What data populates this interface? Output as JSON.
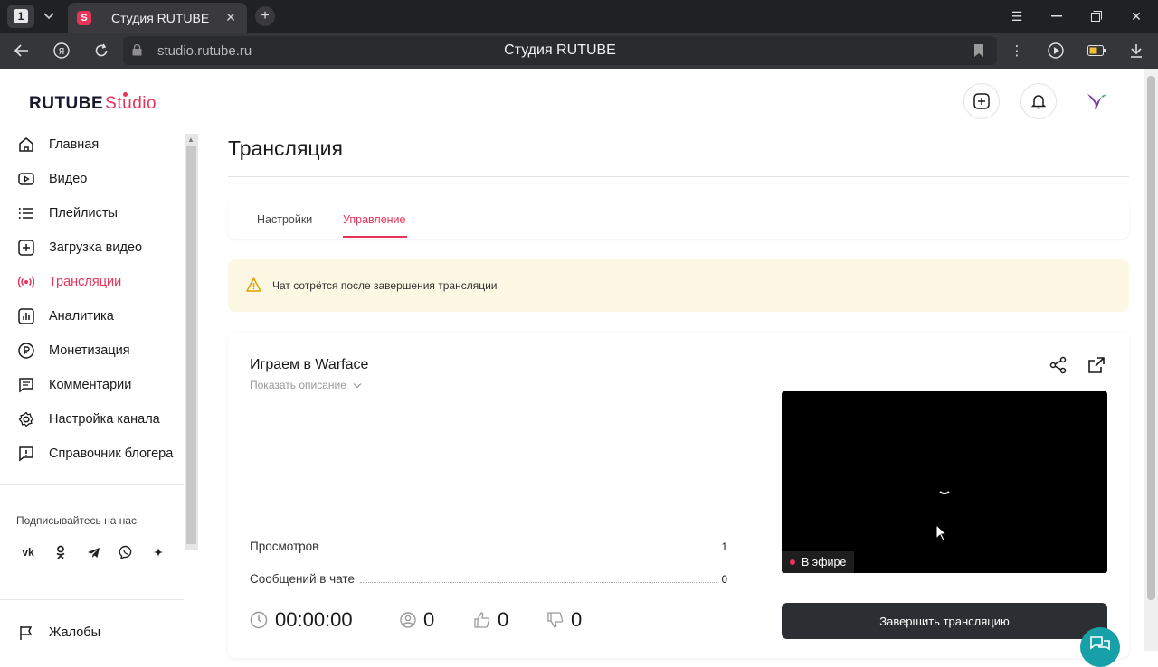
{
  "browser": {
    "tab_count": "1",
    "tab_title": "Студия RUTUBE",
    "favicon_letter": "S",
    "url": "studio.rutube.ru",
    "page_title": "Студия RUTUBE"
  },
  "app": {
    "logo_main": "RUTUBE",
    "logo_sub": "Studio",
    "brand_color": "#e8345b"
  },
  "sidebar": {
    "items": [
      {
        "label": "Главная",
        "icon": "home-icon"
      },
      {
        "label": "Видео",
        "icon": "video-icon"
      },
      {
        "label": "Плейлисты",
        "icon": "playlist-icon"
      },
      {
        "label": "Загрузка видео",
        "icon": "upload-icon"
      },
      {
        "label": "Трансляции",
        "icon": "broadcast-icon",
        "active": true
      },
      {
        "label": "Аналитика",
        "icon": "analytics-icon"
      },
      {
        "label": "Монетизация",
        "icon": "ruble-icon"
      },
      {
        "label": "Комментарии",
        "icon": "comment-icon"
      },
      {
        "label": "Настройка канала",
        "icon": "gear-icon"
      },
      {
        "label": "Справочник блогера",
        "icon": "info-icon"
      }
    ],
    "follow_label": "Подписывайтесь на нас",
    "socials": [
      "vk",
      "ok",
      "telegram",
      "viber",
      "zen"
    ],
    "complaints": "Жалобы"
  },
  "main": {
    "title": "Трансляция",
    "tabs": [
      {
        "label": "Настройки"
      },
      {
        "label": "Управление",
        "active": true
      }
    ],
    "alert": "Чат сотрётся после завершения трансляции",
    "stream": {
      "title": "Играем в Warface",
      "show_description": "Показать описание",
      "stats": [
        {
          "label": "Просмотров",
          "value": "1"
        },
        {
          "label": "Сообщений в чате",
          "value": "0"
        }
      ],
      "live_label": "В эфире",
      "duration": "00:00:00",
      "viewers": "0",
      "likes": "0",
      "dislikes": "0",
      "end_button": "Завершить трансляцию"
    }
  }
}
